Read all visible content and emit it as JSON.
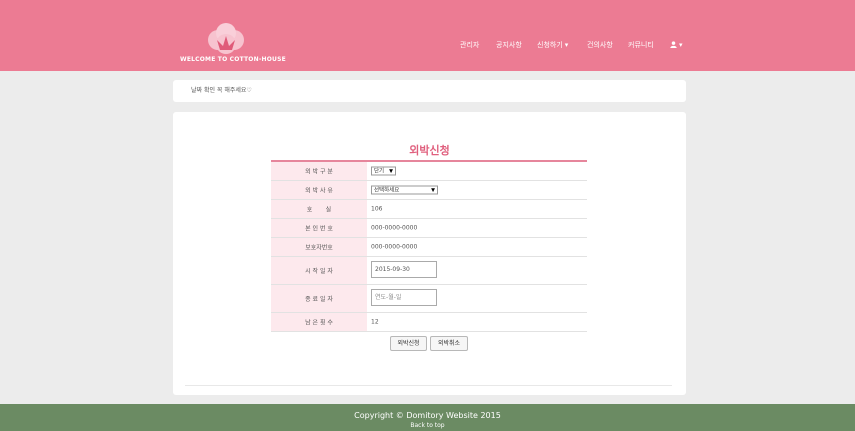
{
  "header": {
    "logo_text": "WELCOME TO COTTON-HOUSE",
    "nav": [
      "관리자",
      "공지사항",
      "신청하기",
      "건의사항",
      "커뮤니티"
    ],
    "nav_dropdown": [
      "chevron-down-icon"
    ],
    "user_icon": "user-icon",
    "colors": {
      "header": "#ec7b93",
      "footer": "#6b8b63",
      "accent": "#e0607e"
    }
  },
  "notice": {
    "text": "날짜 확인 꼭 해주세요♡"
  },
  "form": {
    "title": "외박신청",
    "rows": [
      {
        "label": "외 박 구 분",
        "value": "단기"
      },
      {
        "label": "외 박 사 유",
        "value": "선택하세요"
      },
      {
        "label": "호       실",
        "value": "106"
      },
      {
        "label": "본 인 번 호",
        "value": "000-0000-0000"
      },
      {
        "label": "보호자번호",
        "value": "000-0000-0000"
      },
      {
        "label": "시 작 일 자",
        "value": "2015-09-30"
      },
      {
        "label": "종 료 일 자",
        "placeholder": "연도-월-일"
      },
      {
        "label": "남 은 횟 수",
        "value": "12"
      }
    ],
    "submit_label": "외박신청",
    "cancel_label": "외박취소"
  },
  "footer": {
    "copyright": "Copyright © Domitory Website 2015",
    "back_to_top": "Back to top"
  }
}
